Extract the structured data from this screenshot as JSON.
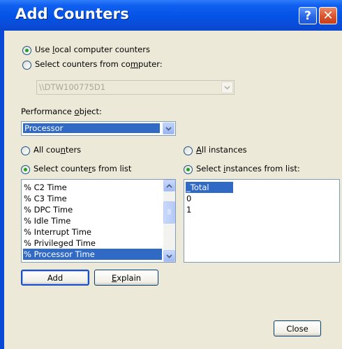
{
  "window": {
    "title": "Add Counters",
    "help_icon": "question-mark",
    "close_icon": "x-glyph"
  },
  "source": {
    "use_local": {
      "pre": "Use ",
      "key": "l",
      "post": "ocal computer counters",
      "checked": true
    },
    "select_computer": {
      "pre": "Select counters from co",
      "key": "m",
      "post": "puter:",
      "checked": false
    },
    "computer_value": "\\\\DTW100775D1"
  },
  "performance_object": {
    "label_pre": "Performance ",
    "label_key": "o",
    "label_post": "bject:",
    "value": "Processor"
  },
  "counters": {
    "all": {
      "pre": "All cou",
      "key": "n",
      "post": "ters",
      "checked": false
    },
    "from_list": {
      "pre": "Select counte",
      "key": "r",
      "post": "s from list",
      "checked": true
    },
    "items": [
      "% C2 Time",
      "% C3 Time",
      "% DPC Time",
      "% Idle Time",
      "% Interrupt Time",
      "% Privileged Time",
      "% Processor Time"
    ],
    "selected": "% Processor Time"
  },
  "instances": {
    "all": {
      "pre": "",
      "key": "A",
      "post": "ll instances",
      "checked": false
    },
    "from_list": {
      "pre": "Select ",
      "key": "i",
      "post": "nstances from list:",
      "checked": true
    },
    "items": [
      "_Total",
      "0",
      "1"
    ],
    "selected": "_Total"
  },
  "buttons": {
    "add": "Add",
    "explain_key": "E",
    "explain_rest": "xplain",
    "close": "Close"
  },
  "colors": {
    "title_bar": "#0553e6",
    "dialog_bg": "#ece9d8",
    "selection": "#316ac5"
  }
}
